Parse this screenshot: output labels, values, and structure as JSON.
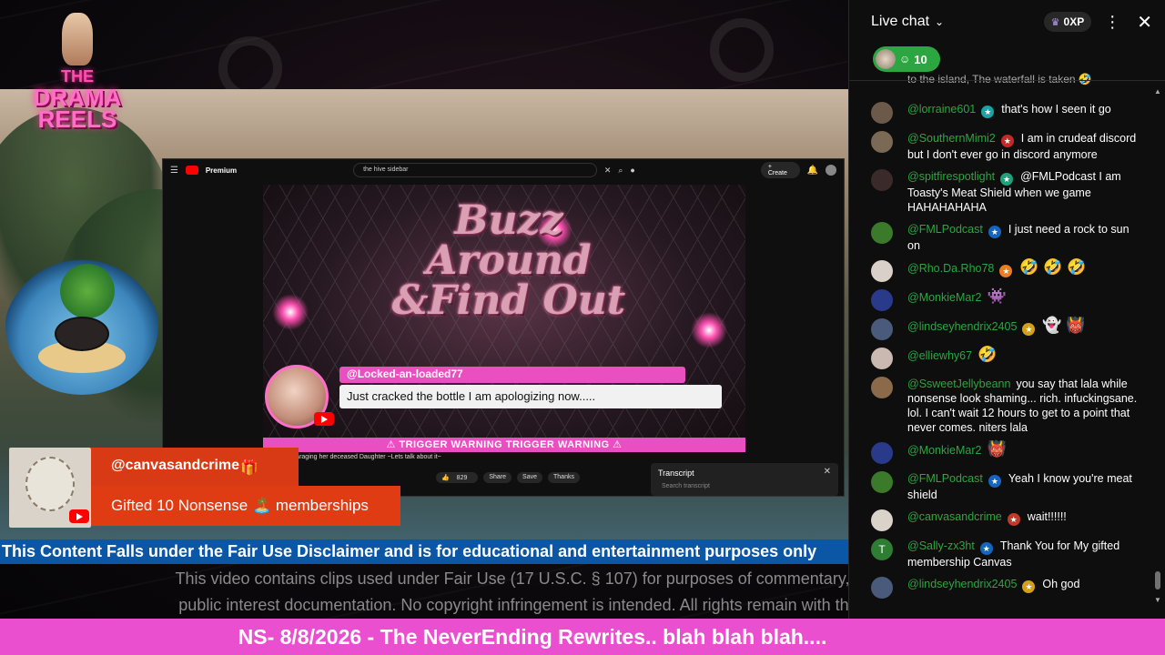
{
  "stream": {
    "logo": {
      "line1": "THE",
      "line2": "DRAMA",
      "line3": "REELS"
    },
    "embedded_youtube": {
      "brand": "Premium",
      "search_value": "the hive sidebar",
      "create_label": "Create",
      "video_title_lines": [
        "Buzz",
        "Around",
        "&Find Out"
      ],
      "highlight_user": "@Locked-an-loaded77",
      "highlight_message": "Just cracked the bottle I am apologizing now.....",
      "trigger_text": "TRIGGER WARNING TRIGGER WARNING",
      "below_title": "Kids & Disparaging her deceased Daughter ~Lets talk about it~",
      "actions": [
        "829",
        "Share",
        "Save",
        "Thanks"
      ],
      "transcript_title": "Transcript",
      "transcript_search": "Search transcript"
    },
    "gift": {
      "user": "@canvasandcrime",
      "message": "Gifted 10 Nonsense 🏝️ memberships"
    },
    "disclaimer": "This Content Falls under the Fair Use Disclaimer and is for educational and entertainment purposes only",
    "fair_use_line1": "This video contains clips used under Fair Use (17 U.S.C. § 107) for purposes of commentary, criticism, and",
    "fair_use_line2": "public interest documentation. No copyright infringement is intended. All rights remain with their respective"
  },
  "ticker": "NS- 8/8/2026 - The NeverEnding Rewrites.. blah blah blah....",
  "chat": {
    "title": "Live chat",
    "xp": "0XP",
    "viewer_count": "10",
    "cut_text": "to the island, The waterfall is taken 🤣",
    "messages": [
      {
        "author": "@lorraine601",
        "text": "that's how I seen it go",
        "badge": "#1aa3a3",
        "avatar": "#6b5a4a"
      },
      {
        "author": "@SouthernMimi2",
        "text": "I am in crudeaf discord but I don't ever go in discord anymore",
        "badge": "#c62828",
        "avatar": "#7a6a55"
      },
      {
        "author": "@spitfirespotlight",
        "text": "@FMLPodcast I am Toasty's Meat Shield when we game HAHAHAHAHA",
        "badge": "#1aa37a",
        "avatar": "#3a2a2a"
      },
      {
        "author": "@FMLPodcast",
        "text": "I just need a rock to sun on",
        "badge": "#1565c0",
        "avatar": "#3b7a2a"
      },
      {
        "author": "@Rho.Da.Rho78",
        "text": "🤣 🤣 🤣",
        "badge": "#e67e22",
        "avatar": "#d9d0c9"
      },
      {
        "author": "@MonkieMar2",
        "text": "👾",
        "badge": "",
        "avatar": "#2a3a8a"
      },
      {
        "author": "@lindseyhendrix2405",
        "text": "👻 👹",
        "badge": "#d4a017",
        "avatar": "#4a5a7a"
      },
      {
        "author": "@elliewhy67",
        "text": "🤣",
        "badge": "",
        "avatar": "#c9b9b0"
      },
      {
        "author": "@SsweetJellybeann",
        "text": "you say that lala while nonsense look shaming... rich. infuckingsane. lol. I can't wait 12 hours to get to a point that never comes. niters lala",
        "badge": "",
        "avatar": "#8a6a4a"
      },
      {
        "author": "@MonkieMar2",
        "text": "👹",
        "badge": "",
        "avatar": "#2a3a8a"
      },
      {
        "author": "@FMLPodcast",
        "text": "Yeah I know you're meat shield",
        "badge": "#1565c0",
        "avatar": "#3b7a2a"
      },
      {
        "author": "@canvasandcrime",
        "text": "wait!!!!!!",
        "badge": "#c0392b",
        "avatar": "#d9d3c9"
      },
      {
        "author": "@Sally-zx3ht",
        "text": "Thank You for My gifted membership Canvas",
        "badge": "#1565c0",
        "avatar": "#2e7d32",
        "initial": "T"
      },
      {
        "author": "@lindseyhendrix2405",
        "text": "Oh god",
        "badge": "#d4a017",
        "avatar": "#4a5a7a"
      }
    ]
  }
}
